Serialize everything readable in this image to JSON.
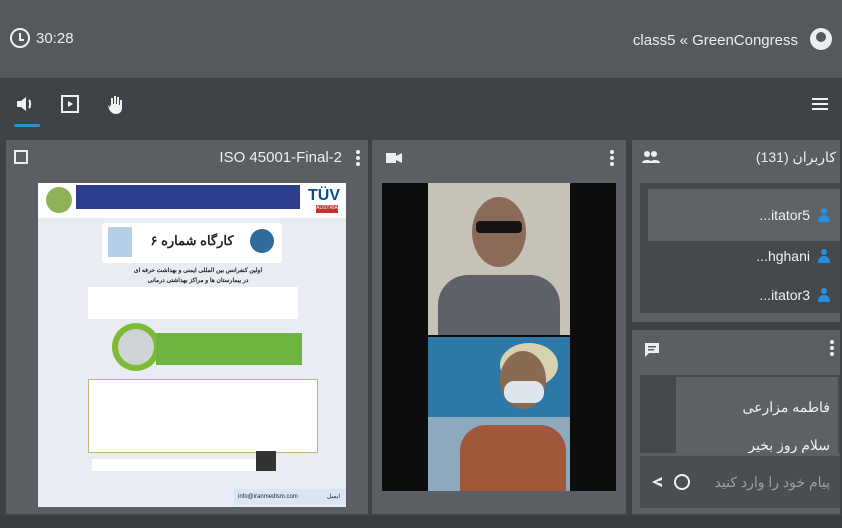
{
  "header": {
    "timer": "30:28",
    "title": "class5 « GreenCongress"
  },
  "presentation": {
    "title": "ISO 45001-Final-2",
    "slide": {
      "tuv_label": "TÜV",
      "tuv_sub": "AUSTRIA",
      "workshop_title": "کارگاه شماره ۶",
      "line1": "اولین کنفرانس بین المللی ایمنی و بهداشت حرفه ای",
      "line2": "در بیمارستان ها و مراکز بهداشتی درمانی",
      "footer_email": "info@iranmedlsm.com",
      "footer_label": "ایمیل"
    }
  },
  "users": {
    "title": "کاربران (131)",
    "items": [
      "...itator5",
      "...hghani",
      "...itator3"
    ]
  },
  "chat": {
    "messages": [
      "فاطمه مزارعی",
      "سلام روز بخیر"
    ],
    "input_placeholder": "پیام خود را وارد کنید"
  },
  "icons": {
    "timer": "clock-icon",
    "audio": "speaker-icon",
    "screen": "screen-share-icon",
    "hand": "raise-hand-icon",
    "menu": "hamburger-menu-icon",
    "video": "video-camera-icon",
    "users": "users-group-icon",
    "chat": "chat-icon",
    "emoji": "emoji-icon",
    "send": "send-icon"
  },
  "colors": {
    "accent": "#2b8fd8",
    "panel": "#5b5f63",
    "topbar": "#55595d"
  }
}
